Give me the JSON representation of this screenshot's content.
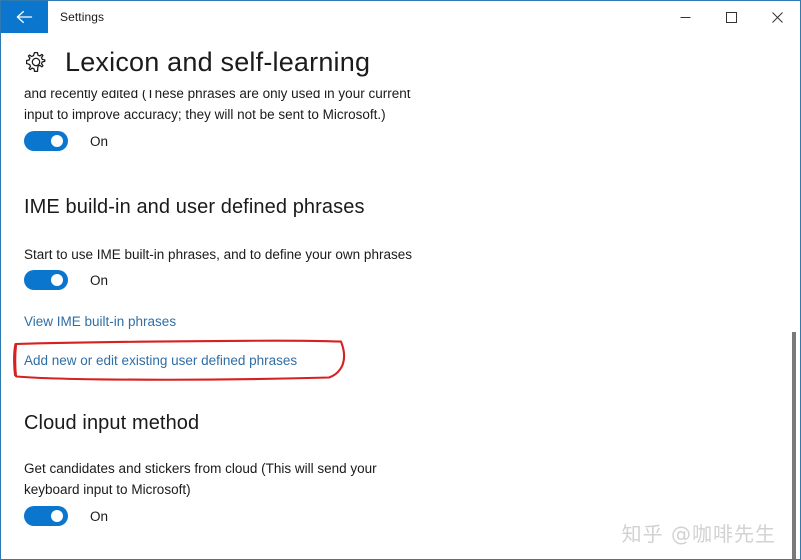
{
  "window": {
    "app_title": "Settings",
    "back_icon": "back-arrow-icon",
    "minimize_label": "─",
    "maximize_label": "□",
    "close_label": "✕",
    "border_color": "#2f7ab0",
    "accent_color": "#0b76ce"
  },
  "header": {
    "gear_icon": "gear-icon",
    "title": "Lexicon and self-learning"
  },
  "sections": {
    "lexicon": {
      "description_line1": "and recently edited (These phrases are only used in your current",
      "description_line2": "input to improve accuracy; they will not be sent to Microsoft.)",
      "toggle_state": "On"
    },
    "ime": {
      "heading": "IME build-in and user defined phrases",
      "description": "Start to use IME built-in phrases, and to define your own phrases",
      "toggle_state": "On",
      "link_view": "View IME built-in phrases",
      "link_add": "Add new or edit existing user defined phrases"
    },
    "cloud": {
      "heading": "Cloud input method",
      "description_line1": "Get candidates and stickers from cloud (This will send your",
      "description_line2": "keyboard input to Microsoft)",
      "toggle_state": "On"
    }
  },
  "annotation": {
    "color": "#d72020",
    "target": "Add new or edit existing user defined phrases"
  },
  "watermark": {
    "text": "知乎 @咖啡先生"
  }
}
